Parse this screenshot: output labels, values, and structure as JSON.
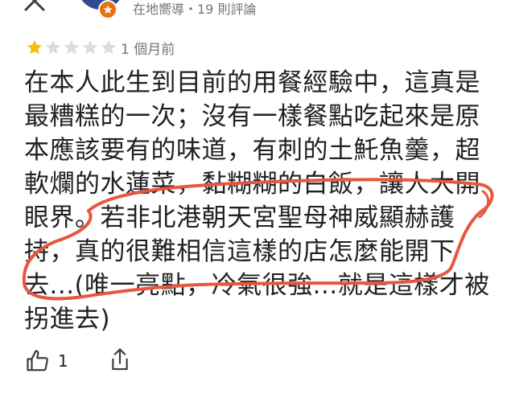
{
  "reviewer": {
    "meta": "在地嚮導・19 則評論"
  },
  "rating": {
    "stars": 1,
    "max": 5,
    "time": "1 個月前"
  },
  "review": {
    "lines": [
      "在本人此生到目前的用餐經驗中，這真是",
      "最糟糕的一次；沒有一樣餐點吃起來是原",
      "本應該要有的味道，有刺的土魠魚羹，超",
      "軟爛的水蓮菜，黏糊糊的白飯，讓人大開",
      "眼界。若非北港朝天宮聖母神威顯赫護",
      "持，真的很難相信這樣的店怎麼能開下",
      "去...(唯一亮點，冷氣很強...就是這樣才被",
      "拐進去)"
    ]
  },
  "actions": {
    "like_count": "1"
  },
  "colors": {
    "star_filled": "#fbbc04",
    "star_empty": "#dadce0",
    "annotation": "#e8563f",
    "guide_badge": "#e8710a"
  }
}
